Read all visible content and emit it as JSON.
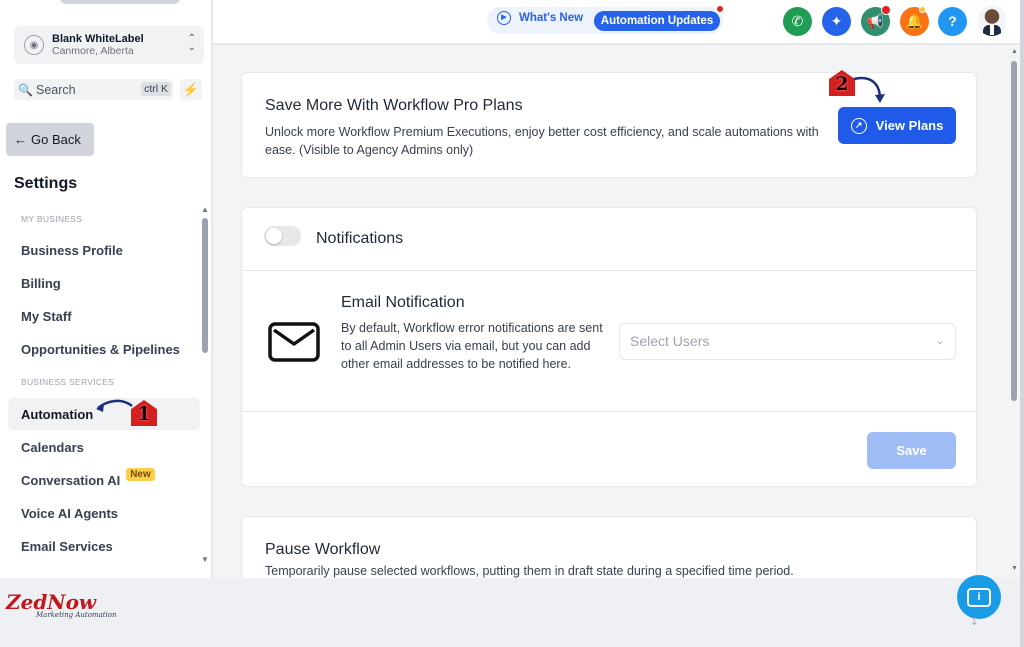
{
  "account": {
    "name": "Blank WhiteLabel",
    "location": "Canmore, Alberta"
  },
  "search": {
    "label": "Search",
    "shortcut": "ctrl K"
  },
  "sidebar": {
    "go_back": "Go Back",
    "heading": "Settings",
    "section_business": "MY BUSINESS",
    "section_services": "BUSINESS SERVICES",
    "items": [
      {
        "label": "Business Profile"
      },
      {
        "label": "Billing"
      },
      {
        "label": "My Staff"
      },
      {
        "label": "Opportunities & Pipelines"
      },
      {
        "label": "Automation",
        "active": true
      },
      {
        "label": "Calendars"
      },
      {
        "label": "Conversation AI",
        "badge": "New"
      },
      {
        "label": "Voice AI Agents"
      },
      {
        "label": "Email Services"
      }
    ]
  },
  "annotations": {
    "step1": "1",
    "step2": "2"
  },
  "brand": {
    "logo_text": "ZedNow",
    "tagline": "Marketing Automation"
  },
  "topbar": {
    "whats_new": "What's New",
    "automation_updates": "Automation Updates",
    "icons": [
      "phone-icon",
      "magic-wand-icon",
      "megaphone-icon",
      "bell-icon",
      "help-icon"
    ],
    "colors": {
      "phone": "#1f9d55",
      "magic": "#2563eb",
      "megaphone": "#2f8f6f",
      "bell": "#f97316",
      "help": "#2196f3"
    }
  },
  "workflow_pro": {
    "title": "Save More With Workflow Pro Plans",
    "description": "Unlock more Workflow Premium Executions, enjoy better cost efficiency, and scale automations with ease. (Visible to Agency Admins only)",
    "button": "View Plans"
  },
  "notifications": {
    "title": "Notifications",
    "enabled": false,
    "email": {
      "title": "Email Notification",
      "description": "By default, Workflow error notifications are sent to all Admin Users via email, but you can add other email addresses to be notified here.",
      "select_placeholder": "Select Users"
    },
    "save": "Save"
  },
  "pause_workflow": {
    "title": "Pause Workflow",
    "description": "Temporarily pause selected workflows, putting them in draft state during a specified time period."
  }
}
